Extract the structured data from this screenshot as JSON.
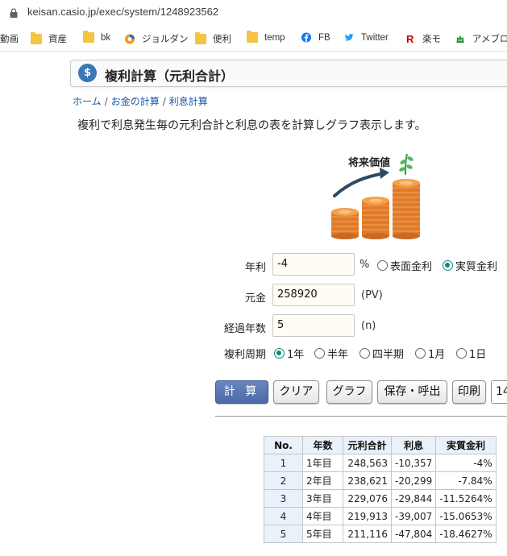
{
  "browser": {
    "url": "keisan.casio.jp/exec/system/1248923562",
    "bookmarks": [
      {
        "label": "動画",
        "icon": "folder-icon"
      },
      {
        "label": "資産",
        "icon": "folder-icon"
      },
      {
        "label": "bk",
        "icon": "folder-icon"
      },
      {
        "label": "ジョルダン",
        "icon": "jorudan-icon"
      },
      {
        "label": "便利",
        "icon": "folder-icon"
      },
      {
        "label": "temp",
        "icon": "folder-icon"
      },
      {
        "label": "FB",
        "icon": "facebook-icon"
      },
      {
        "label": "Twitter",
        "icon": "twitter-icon"
      },
      {
        "label": "楽モ",
        "icon": "rakuten-icon"
      },
      {
        "label": "アメブロ",
        "icon": "ameblo-icon"
      }
    ]
  },
  "page": {
    "title": "複利計算（元利合計）",
    "breadcrumbs": [
      "ホーム",
      "お金の計算",
      "利息計算"
    ],
    "description": "複利で利息発生毎の元利合計と利息の表を計算しグラフ表示します。",
    "illustration_label": "将来価値"
  },
  "form": {
    "rate_label": "年利",
    "rate_value": "-4",
    "rate_unit": "%",
    "rate_type_options": [
      {
        "label": "表面金利",
        "selected": false
      },
      {
        "label": "実質金利",
        "selected": true
      }
    ],
    "principal_label": "元金",
    "principal_value": "258920",
    "principal_unit": "(PV)",
    "years_label": "経過年数",
    "years_value": "5",
    "years_unit": "(n)",
    "period_label": "複利周期",
    "period_options": [
      {
        "label": "1年",
        "selected": true
      },
      {
        "label": "半年",
        "selected": false
      },
      {
        "label": "四半期",
        "selected": false
      },
      {
        "label": "1月",
        "selected": false
      },
      {
        "label": "1日",
        "selected": false
      }
    ]
  },
  "buttons": {
    "calculate": "計 算",
    "clear": "クリア",
    "graph": "グラフ",
    "save": "保存・呼出",
    "print": "印刷",
    "digits": "14"
  },
  "results": {
    "headers": [
      "No.",
      "年数",
      "元利合計",
      "利息",
      "実質金利"
    ],
    "rows": [
      [
        "1",
        "1年目",
        "248,563",
        "-10,357",
        "-4%"
      ],
      [
        "2",
        "2年目",
        "238,621",
        "-20,299",
        "-7.84%"
      ],
      [
        "3",
        "3年目",
        "229,076",
        "-29,844",
        "-11.5264%"
      ],
      [
        "4",
        "4年目",
        "219,913",
        "-39,007",
        "-15.0653%"
      ],
      [
        "5",
        "5年目",
        "211,116",
        "-47,804",
        "-18.4627%"
      ]
    ]
  },
  "colors": {
    "primary_button": "#4d69a8",
    "radio_checked": "#0f8a7e",
    "link": "#1a57a8",
    "table_header_bg": "#e9f2fb",
    "input_bg": "#fffdf3"
  }
}
